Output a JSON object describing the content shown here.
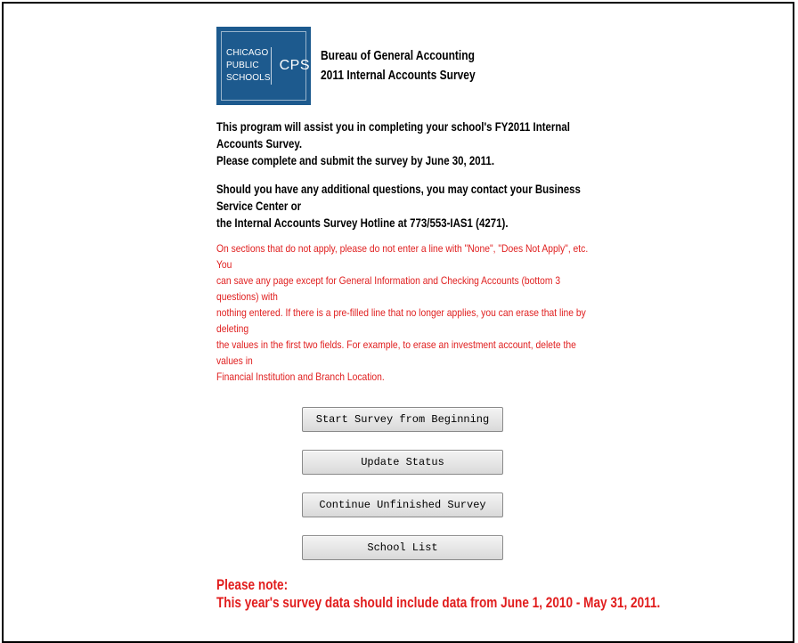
{
  "logo": {
    "line1": "CHICAGO",
    "line2": "PUBLIC",
    "line3": "SCHOOLS",
    "abbr": "CPS"
  },
  "header": {
    "title": "Bureau of General Accounting",
    "subtitle": "2011 Internal Accounts Survey"
  },
  "intro": {
    "line1": "This program will assist you in completing your school's FY2011 Internal Accounts Survey.",
    "line2": "Please complete and submit the survey by June 30, 2011."
  },
  "contact": {
    "line1": "Should you have any additional questions, you may contact your Business Service Center or",
    "line2": "the Internal Accounts Survey Hotline at 773/553-IAS1 (4271)."
  },
  "warning": {
    "line1": "On sections that do not apply, please do not enter a line with \"None\", \"Does Not Apply\", etc.   You",
    "line2": "can save any page except for General Information and Checking Accounts (bottom 3 questions) with",
    "line3": "nothing entered.   If there is a pre-filled line that no longer applies, you can erase that line by deleting",
    "line4": "the values in the first two fields.   For example, to erase an investment account, delete the values in",
    "line5": "Financial Institution and Branch Location."
  },
  "buttons": {
    "start": "Start Survey from Beginning",
    "update": "Update Status",
    "continue": "Continue Unfinished Survey",
    "schools": "School List"
  },
  "note": {
    "heading": "Please note:",
    "text": "This year's survey data should include data from June 1, 2010 - May 31, 2011."
  },
  "colors": {
    "logo_bg": "#1d5a8e",
    "warning_text": "#e02020",
    "note_text": "#e11d1d"
  }
}
